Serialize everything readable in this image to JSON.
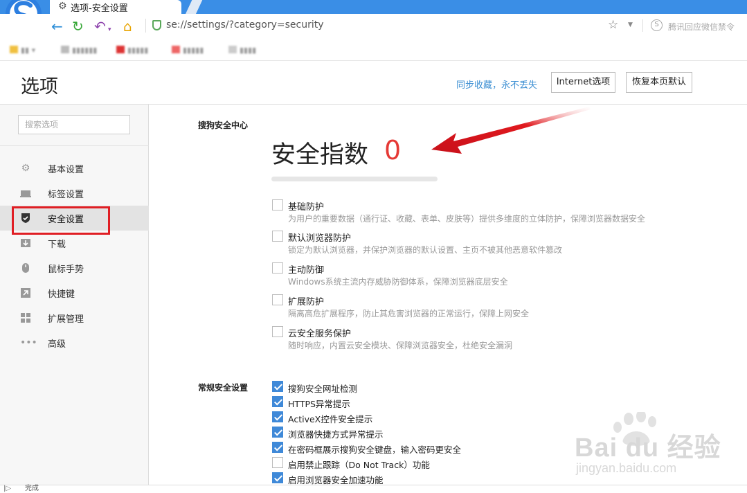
{
  "window": {
    "tab_icon": "gear-icon",
    "tab_title": "选项-安全设置",
    "brand_color": "#3a8ee6"
  },
  "toolbar": {
    "url": "se://settings/?category=security",
    "ext_icon_label": "S",
    "ext_text": "腾讯回应微信禁令"
  },
  "page": {
    "title": "选项",
    "sync_link": "同步收藏，永不丢失",
    "internet_button": "Internet选项",
    "restore_button": "恢复本页默认"
  },
  "sidebar": {
    "search_placeholder": "搜索选项",
    "items": [
      {
        "label": "基本设置",
        "icon": "gear-icon"
      },
      {
        "label": "标签设置",
        "icon": "tab-icon"
      },
      {
        "label": "安全设置",
        "icon": "shield-icon",
        "active": true
      },
      {
        "label": "下载",
        "icon": "download-icon"
      },
      {
        "label": "鼠标手势",
        "icon": "mouse-icon"
      },
      {
        "label": "快捷键",
        "icon": "shortcut-icon"
      },
      {
        "label": "扩展管理",
        "icon": "extensions-icon"
      },
      {
        "label": "高级",
        "icon": "more-icon"
      }
    ]
  },
  "security_center": {
    "label": "搜狗安全中心",
    "score_title": "安全指数",
    "score_value": "0",
    "score_progress": 0,
    "protections": [
      {
        "title": "基础防护",
        "desc": "为用户的重要数据（通行证、收藏、表单、皮肤等）提供多维度的立体防护，保障浏览器数据安全",
        "checked": false
      },
      {
        "title": "默认浏览器防护",
        "desc": "锁定为默认浏览器，并保护浏览器的默认设置、主页不被其他恶意软件篡改",
        "checked": false
      },
      {
        "title": "主动防御",
        "desc": "Windows系统主流内存威胁防御体系，保障浏览器底层安全",
        "checked": false
      },
      {
        "title": "扩展防护",
        "desc": "隔离高危扩展程序，防止其危害浏览器的正常运行，保障上网安全",
        "checked": false
      },
      {
        "title": "云安全服务保护",
        "desc": "随时响应，内置云安全模块、保障浏览器安全，杜绝安全漏洞",
        "checked": false
      }
    ]
  },
  "general_security": {
    "label": "常规安全设置",
    "options": [
      {
        "label": "搜狗安全网址检测",
        "checked": true
      },
      {
        "label": "HTTPS异常提示",
        "checked": true
      },
      {
        "label": "ActiveX控件安全提示",
        "checked": true
      },
      {
        "label": "浏览器快捷方式异常提示",
        "checked": true
      },
      {
        "label": "在密码框展示搜狗安全键盘，输入密码更安全",
        "checked": true
      },
      {
        "label": "启用禁止跟踪（Do Not Track）功能",
        "checked": false
      },
      {
        "label": "启用浏览器安全加速功能",
        "checked": true
      }
    ]
  },
  "watermark": {
    "brand": "Bai du 经验",
    "url": "jingyan.baidu.com"
  },
  "statusbar": {
    "text": "完成"
  },
  "colors": {
    "accent_red": "#e53935",
    "checkbox_blue": "#3f89d8",
    "link_blue": "#3c8fd3"
  }
}
